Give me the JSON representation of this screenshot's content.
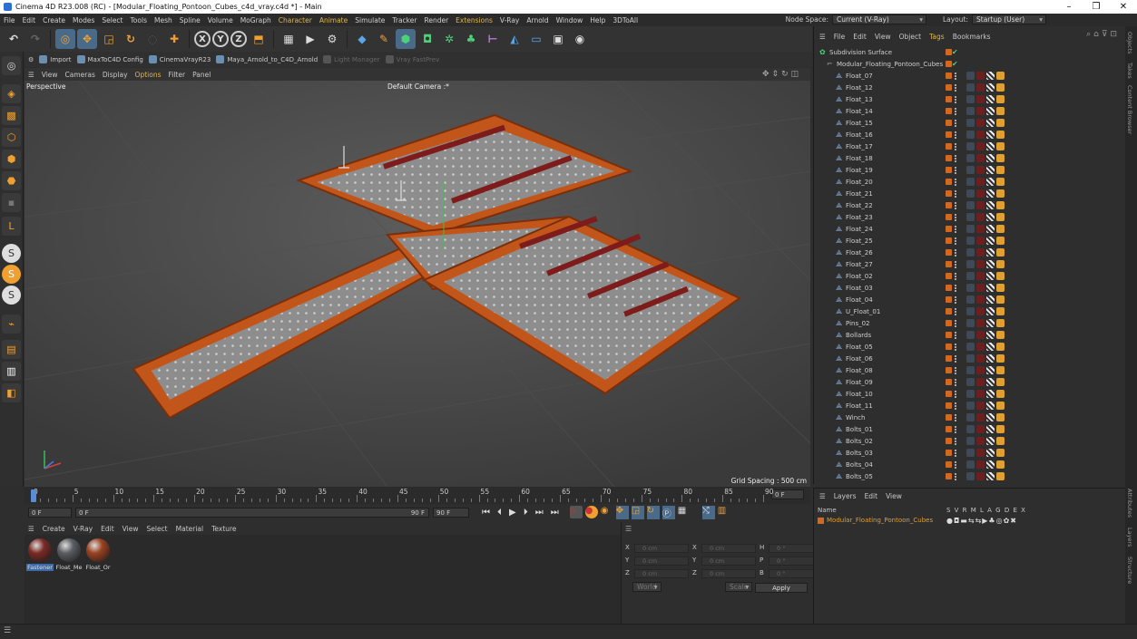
{
  "window": {
    "title": "Cinema 4D R23.008 (RC) - [Modular_Floating_Pontoon_Cubes_c4d_vray.c4d *] - Main",
    "min": "–",
    "max": "❒",
    "close": "✕"
  },
  "menu": [
    "File",
    "Edit",
    "Create",
    "Modes",
    "Select",
    "Tools",
    "Mesh",
    "Spline",
    "Volume",
    "MoGraph",
    "Character",
    "Animate",
    "Simulate",
    "Tracker",
    "Render",
    "Extensions",
    "V-Ray",
    "Arnold",
    "Window",
    "Help",
    "3DToAll"
  ],
  "node_space": {
    "label": "Node Space:",
    "value": "Current (V-Ray)"
  },
  "layout": {
    "label": "Layout:",
    "value": "Startup (User)"
  },
  "toolbar": {
    "undo_icon": "undo-icon",
    "redo_icon": "redo-icon"
  },
  "plugins": [
    {
      "label": "Import",
      "enabled": true
    },
    {
      "label": "MaxToC4D Config",
      "enabled": true
    },
    {
      "label": "CinemaVrayR23",
      "enabled": true
    },
    {
      "label": "Maya_Arnold_to_C4D_Arnold",
      "enabled": true
    },
    {
      "label": "Light Manager",
      "enabled": false
    },
    {
      "label": "Vray FastPrev",
      "enabled": false
    }
  ],
  "viewport_menu": [
    "View",
    "Cameras",
    "Display",
    "Options",
    "Filter",
    "Panel"
  ],
  "viewport": {
    "name": "Perspective",
    "camera": "Default Camera :*",
    "grid_spacing": "Grid Spacing : 500 cm"
  },
  "timeline": {
    "ticks": [
      "0",
      "5",
      "10",
      "15",
      "20",
      "25",
      "30",
      "35",
      "40",
      "45",
      "50",
      "55",
      "60",
      "65",
      "70",
      "75",
      "80",
      "85",
      "90"
    ],
    "end_label": "0 F"
  },
  "transport": {
    "start": "0 F",
    "current": "0 F",
    "end": "90 F",
    "end2": "90 F"
  },
  "material_menu": [
    "Create",
    "V-Ray",
    "Edit",
    "View",
    "Select",
    "Material",
    "Texture"
  ],
  "materials": [
    {
      "name": "Fastener",
      "color": "#7a2a24",
      "selected": true
    },
    {
      "name": "Float_Me",
      "color": "#5a5e62",
      "selected": false
    },
    {
      "name": "Float_Or",
      "color": "#9a4220",
      "selected": false
    }
  ],
  "coords": {
    "rows": [
      {
        "a": "X",
        "av": "0 cm",
        "b": "X",
        "bv": "0 cm",
        "c": "H",
        "cv": "0 °"
      },
      {
        "a": "Y",
        "av": "0 cm",
        "b": "Y",
        "bv": "0 cm",
        "c": "P",
        "cv": "0 °"
      },
      {
        "a": "Z",
        "av": "0 cm",
        "b": "Z",
        "bv": "0 cm",
        "c": "B",
        "cv": "0 °"
      }
    ],
    "world": "World",
    "scale": "Scale",
    "apply": "Apply"
  },
  "object_menu": [
    "File",
    "Edit",
    "View",
    "Object",
    "Tags",
    "Bookmarks"
  ],
  "objects": {
    "root": "Subdivision Surface",
    "group": "Modular_Floating_Pontoon_Cubes",
    "items": [
      "Float_07",
      "Float_12",
      "Float_13",
      "Float_14",
      "Float_15",
      "Float_16",
      "Float_17",
      "Float_18",
      "Float_19",
      "Float_20",
      "Float_21",
      "Float_22",
      "Float_23",
      "Float_24",
      "Float_25",
      "Float_26",
      "Float_27",
      "Float_02",
      "Float_03",
      "Float_04",
      "U_Float_01",
      "Pins_02",
      "Bollards",
      "Float_05",
      "Float_06",
      "Float_08",
      "Float_09",
      "Float_10",
      "Float_11",
      "Winch",
      "Bolts_01",
      "Bolts_02",
      "Bolts_03",
      "Bolts_04",
      "Bolts_05"
    ]
  },
  "layers": {
    "menu": [
      "Layers",
      "Edit",
      "View"
    ],
    "name_header": "Name",
    "flags": "S V R M L A G D E X",
    "layer_name": "Modular_Floating_Pontoon_Cubes"
  },
  "side_tabs": [
    "Objects",
    "Takes",
    "Content Browser",
    "Attributes",
    "Layers",
    "Structure"
  ],
  "colors": {
    "accent": "#e0b64a",
    "orange": "#d2691e",
    "selection": "#3d6aa8"
  }
}
